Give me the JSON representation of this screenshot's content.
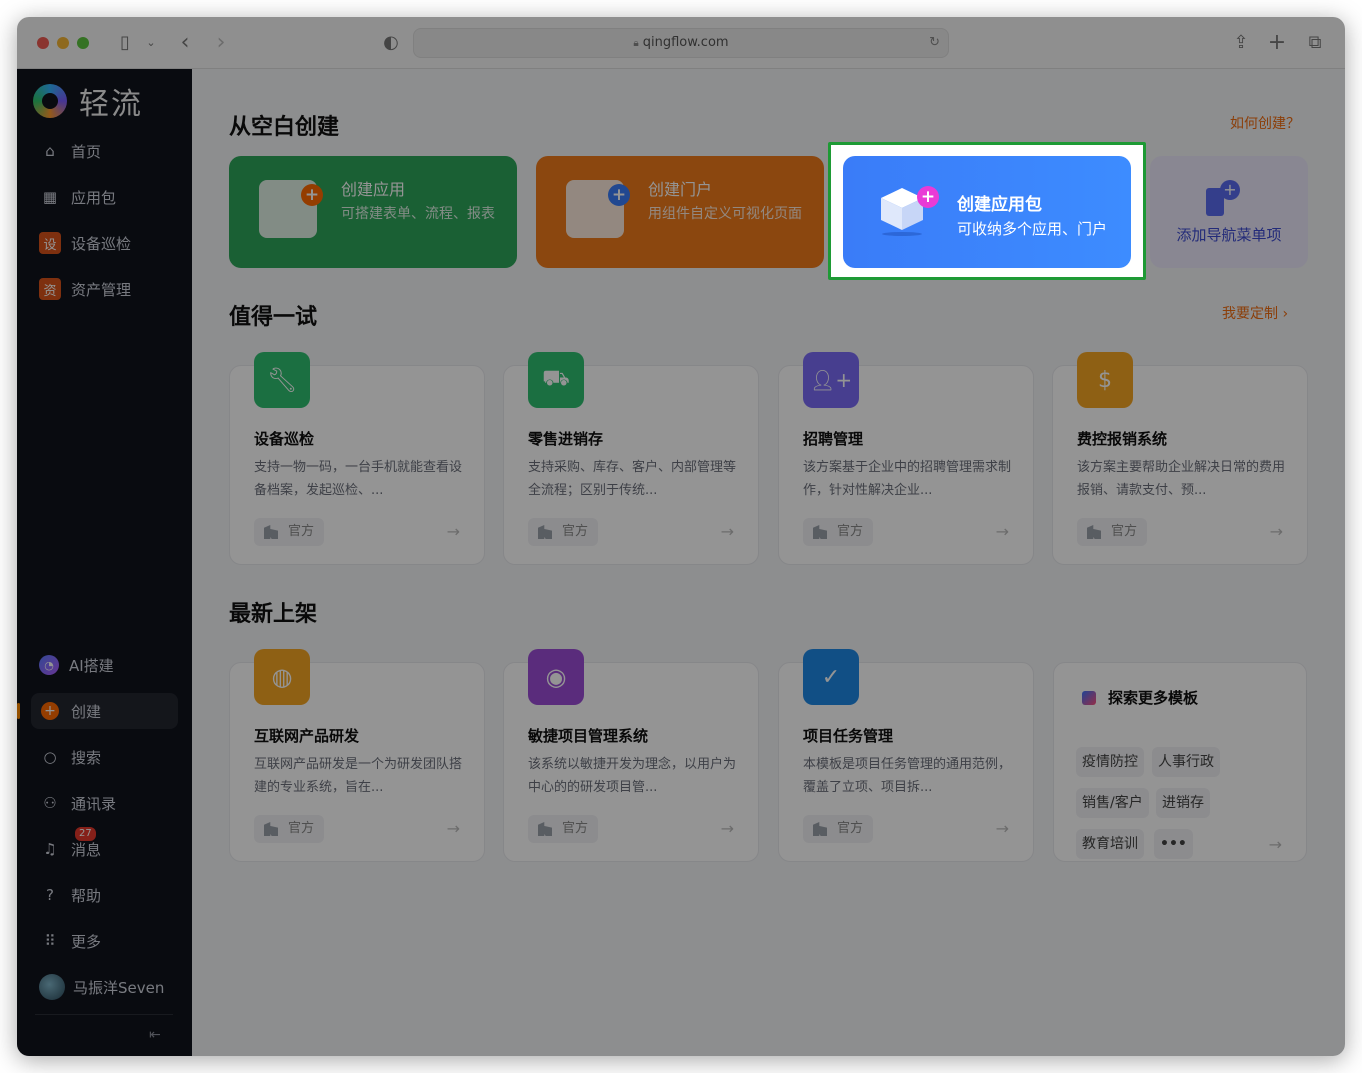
{
  "browser": {
    "url": "qingflow.com"
  },
  "sidebar": {
    "brand": "轻流",
    "top_items": [
      {
        "label": "首页",
        "icon": "home-icon"
      },
      {
        "label": "应用包",
        "icon": "grid-icon"
      },
      {
        "label": "设备巡检",
        "icon": "app-tile-icon",
        "glyph": "设"
      },
      {
        "label": "资产管理",
        "icon": "app-tile-icon",
        "glyph": "资"
      }
    ],
    "bottom_items": [
      {
        "label": "AI搭建",
        "icon": "ai-icon"
      },
      {
        "label": "创建",
        "icon": "plus-circle-icon",
        "active": true
      },
      {
        "label": "搜索",
        "icon": "search-icon"
      },
      {
        "label": "通讯录",
        "icon": "contacts-icon"
      },
      {
        "label": "消息",
        "icon": "bell-icon",
        "badge": "27"
      },
      {
        "label": "帮助",
        "icon": "help-icon"
      },
      {
        "label": "更多",
        "icon": "more-grid-icon"
      }
    ],
    "user": "马振洋Seven"
  },
  "main": {
    "blank_section": {
      "title": "从空白创建",
      "help_link": "如何创建？",
      "cards": [
        {
          "title": "创建应用",
          "desc": "可搭建表单、流程、报表",
          "color": "#2ea55a"
        },
        {
          "title": "创建门户",
          "desc": "用组件自定义可视化页面",
          "color": "#ef7a1a"
        },
        {
          "title": "创建应用包",
          "desc": "可收纳多个应用、门户",
          "color": "#3a7cf8",
          "highlighted": true
        },
        {
          "title": "添加导航菜单项",
          "color": "#ece9fb"
        }
      ]
    },
    "try_section": {
      "title": "值得一试",
      "link": "我要定制 ›",
      "cards": [
        {
          "title": "设备巡检",
          "desc": "支持一物一码，一台手机就能查看设备档案，发起巡检、...",
          "tag": "官方",
          "icon": "wrench-icon",
          "color": "#2fbf71"
        },
        {
          "title": "零售进销存",
          "desc": "支持采购、库存、客户、内部管理等全流程；区别于传统...",
          "tag": "官方",
          "icon": "truck-icon",
          "color": "#2fbf71"
        },
        {
          "title": "招聘管理",
          "desc": "该方案基于企业中的招聘管理需求制作，针对性解决企业...",
          "tag": "官方",
          "icon": "add-user-icon",
          "color": "#7b6cf6"
        },
        {
          "title": "费控报销系统",
          "desc": "该方案主要帮助企业解决日常的费用报销、请款支付、预...",
          "tag": "官方",
          "icon": "money-bag-icon",
          "color": "#f5a623"
        }
      ]
    },
    "new_section": {
      "title": "最新上架",
      "cards": [
        {
          "title": "互联网产品研发",
          "desc": "互联网产品研发是一个为研发团队搭建的专业系统，旨在...",
          "tag": "官方",
          "icon": "globe-icon",
          "color": "#f5a623"
        },
        {
          "title": "敏捷项目管理系统",
          "desc": "该系统以敏捷开发为理念，以用户为中心的的研发项目管...",
          "tag": "官方",
          "icon": "swirl-icon",
          "color": "#9c4dd6"
        },
        {
          "title": "项目任务管理",
          "desc": "本模板是项目任务管理的通用范例，覆盖了立项、项目拆...",
          "tag": "官方",
          "icon": "check-circle-icon",
          "color": "#1e88e5"
        }
      ],
      "explore": {
        "title": "探索更多模板",
        "chips": [
          "疫情防控",
          "人事行政",
          "销售/客户",
          "进销存",
          "教育培训"
        ],
        "more": "•••"
      }
    }
  }
}
